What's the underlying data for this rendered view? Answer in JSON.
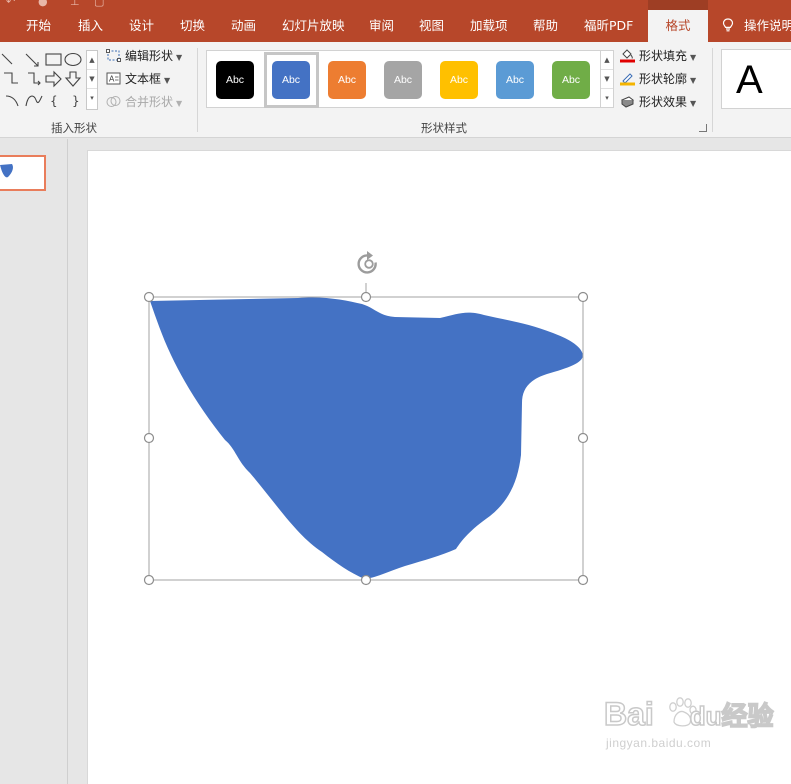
{
  "ribbon_tabs": [
    {
      "label": "开始"
    },
    {
      "label": "插入"
    },
    {
      "label": "设计"
    },
    {
      "label": "切换"
    },
    {
      "label": "动画"
    },
    {
      "label": "幻灯片放映"
    },
    {
      "label": "审阅"
    },
    {
      "label": "视图"
    },
    {
      "label": "加载项"
    },
    {
      "label": "帮助"
    },
    {
      "label": "福昕PDF"
    },
    {
      "label": "格式"
    }
  ],
  "active_tab": "格式",
  "tell_me": "操作说明",
  "insert_shapes_group": {
    "label": "插入形状",
    "edit_shape": "编辑形状",
    "text_box": "文本框",
    "merge_shapes": "合并形状",
    "bracket_left": "{",
    "bracket_right": "}"
  },
  "shape_styles_group": {
    "label": "形状样式",
    "swatches": [
      {
        "text": "Abc",
        "color": "#000000"
      },
      {
        "text": "Abc",
        "color": "#4472c4"
      },
      {
        "text": "Abc",
        "color": "#ed7d31"
      },
      {
        "text": "Abc",
        "color": "#a5a5a5"
      },
      {
        "text": "Abc",
        "color": "#ffc000"
      },
      {
        "text": "Abc",
        "color": "#5b9bd5"
      },
      {
        "text": "Abc",
        "color": "#70ad47"
      }
    ],
    "selected_index": 1,
    "shape_fill": "形状填充",
    "shape_outline": "形状轮廓",
    "shape_effects": "形状效果"
  },
  "wordart_preview": "A",
  "slide_shape": {
    "fill_color": "#4472c4",
    "selection_color": "#a3a3a3"
  },
  "colors": {
    "tab_bar": "#b7472a",
    "thumbnail_border": "#e97d5b"
  },
  "watermark": {
    "brand": "Baidu经验",
    "url": "jingyan.baidu.com"
  }
}
